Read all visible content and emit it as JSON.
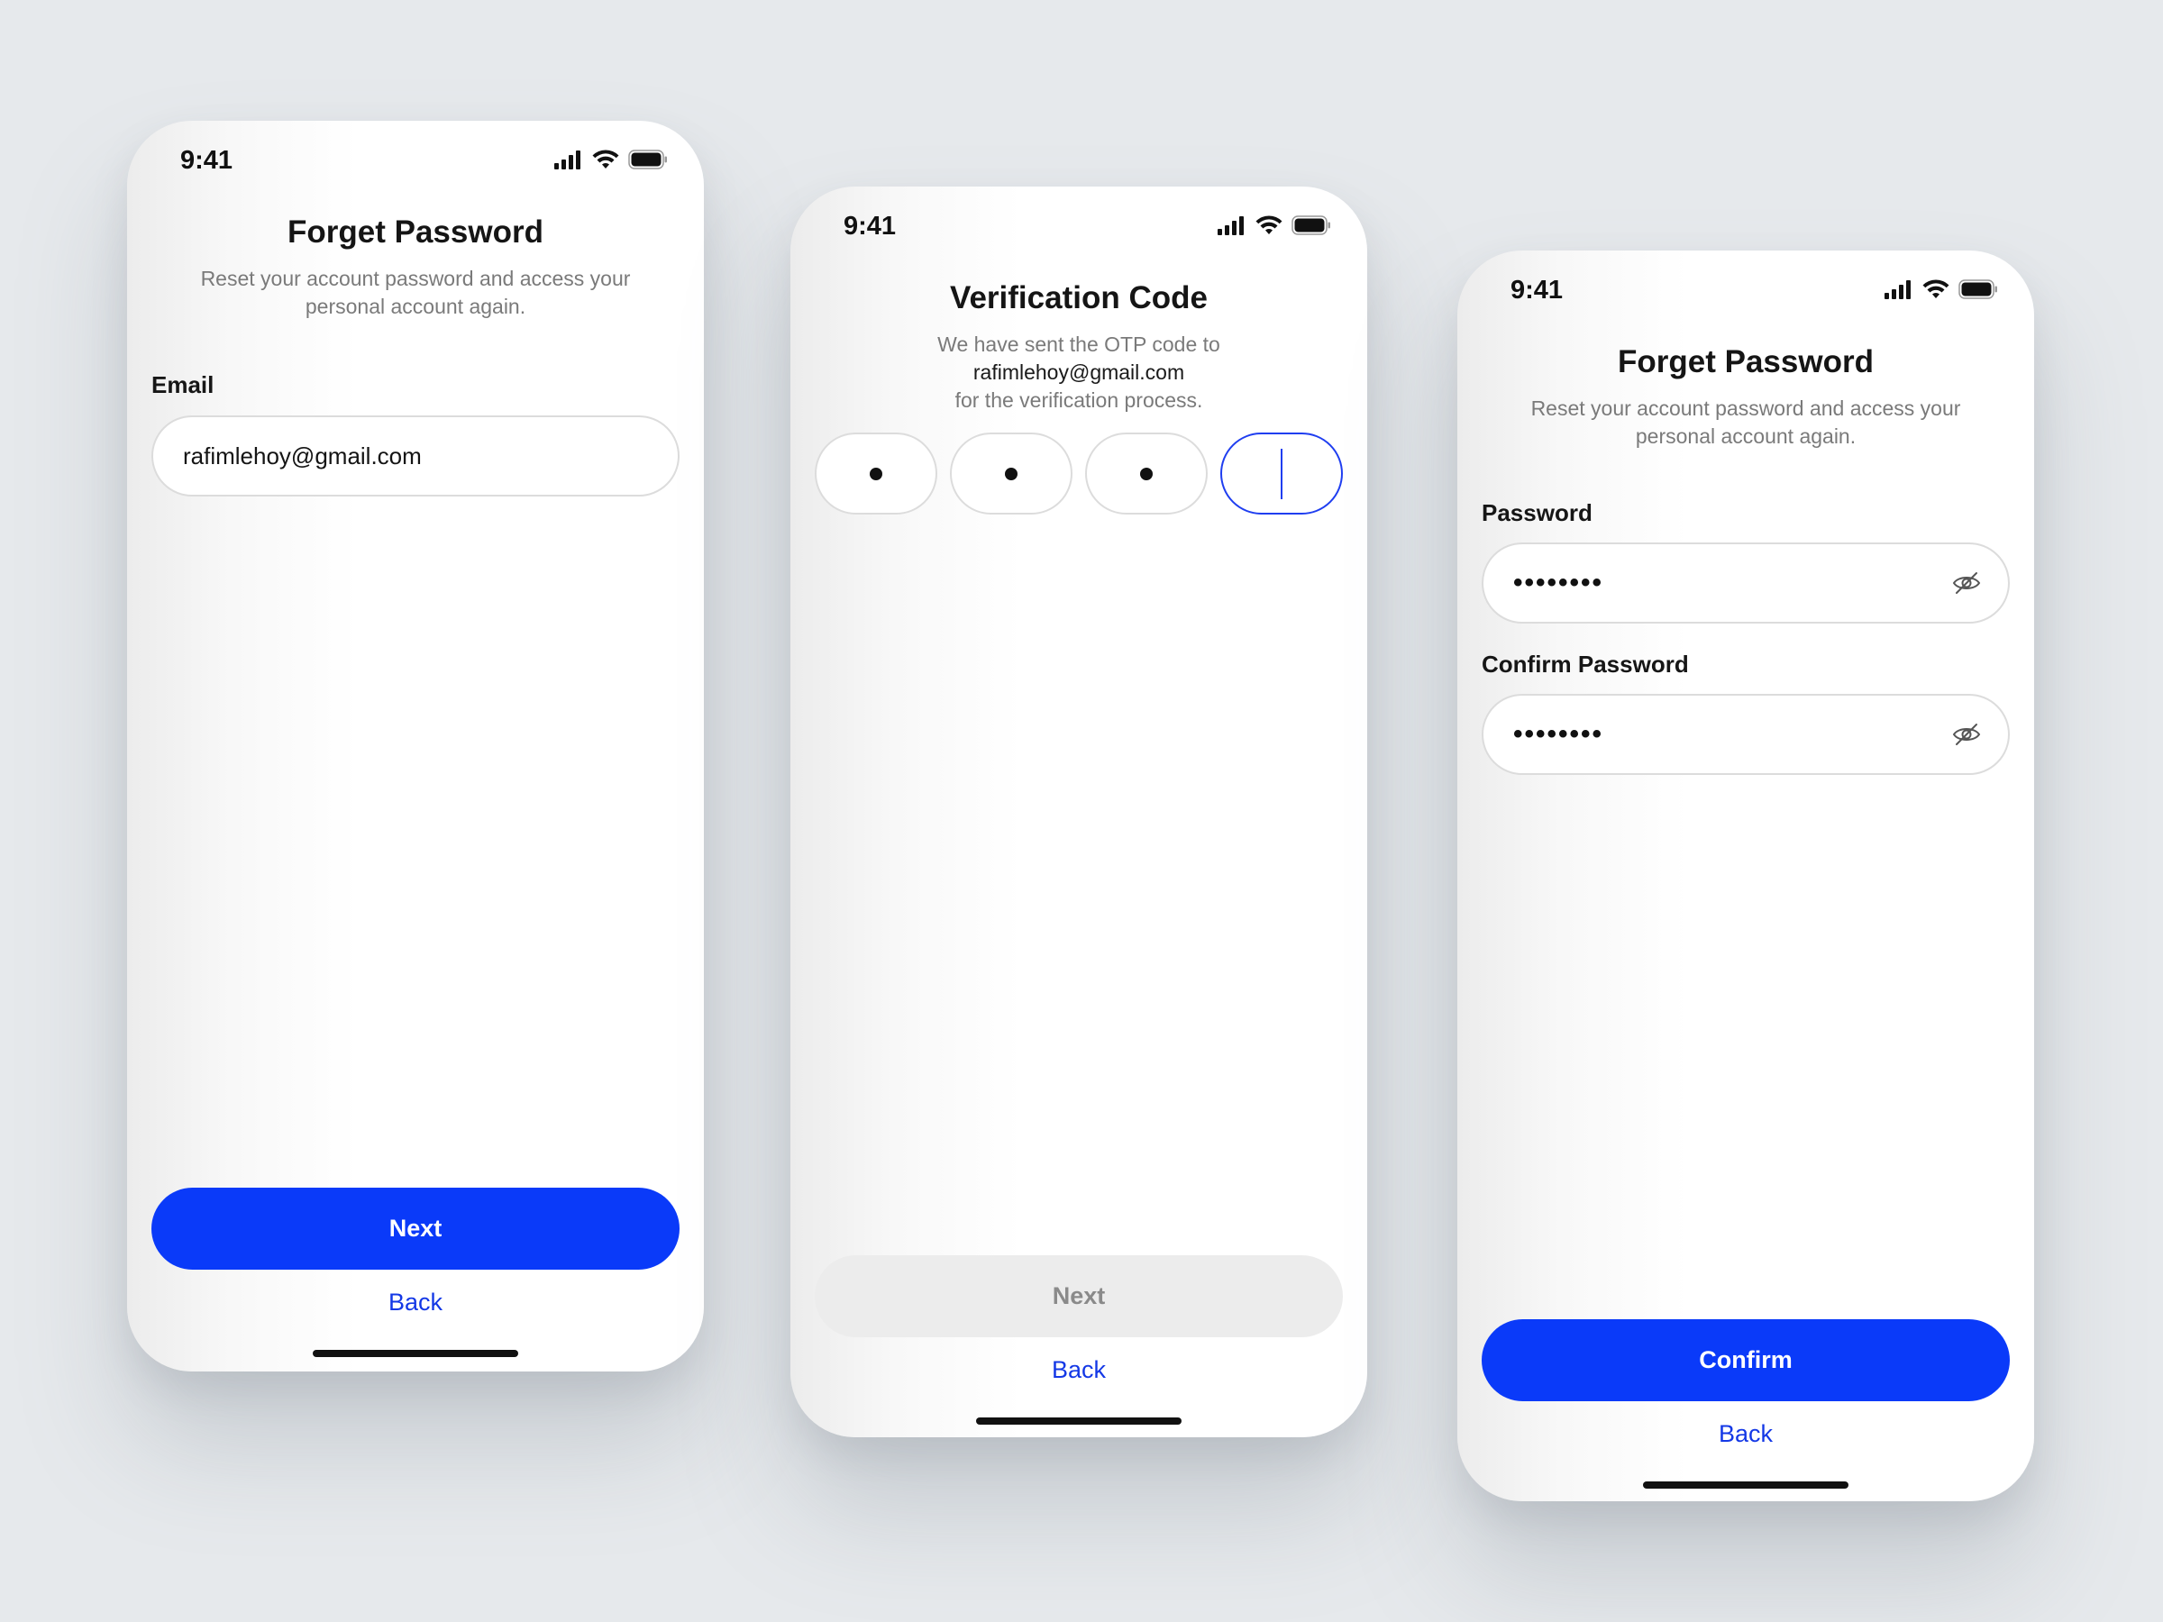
{
  "status_bar": {
    "time": "9:41"
  },
  "screens": [
    {
      "title": "Forget Password",
      "subtitle": "Reset your account password and access your personal account again.",
      "email_label": "Email",
      "email_value": "rafimlehoy@gmail.com",
      "primary_button": "Next",
      "back_link": "Back"
    },
    {
      "title": "Verification Code",
      "subtitle_prefix": "We have sent the OTP code to ",
      "subtitle_email": "rafimlehoy@gmail.com",
      "subtitle_suffix": "for the verification process.",
      "otp_digits_filled": 3,
      "otp_length": 4,
      "primary_button": "Next",
      "primary_button_state": "disabled",
      "back_link": "Back"
    },
    {
      "title": "Forget Password",
      "subtitle": "Reset your account password and access your personal account again.",
      "password_label": "Password",
      "password_value": "••••••••",
      "confirm_label": "Confirm Password",
      "confirm_value": "••••••••",
      "primary_button": "Confirm",
      "back_link": "Back"
    }
  ],
  "icons": {
    "signal": "signal-icon",
    "wifi": "wifi-icon",
    "battery": "battery-icon",
    "eye_off": "eye-off-icon"
  },
  "colors": {
    "accent": "#0a3af9",
    "link": "#1438e6",
    "background": "#e6e9ec"
  }
}
